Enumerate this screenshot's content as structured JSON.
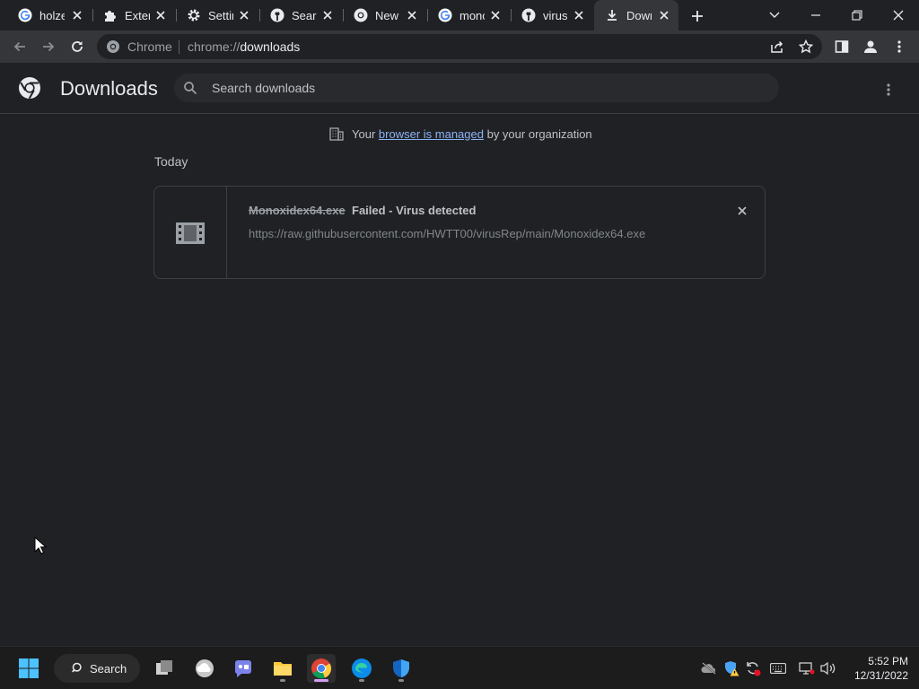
{
  "tabs": [
    {
      "label": "holze",
      "icon": "google-icon",
      "active": false
    },
    {
      "label": "Exten",
      "icon": "puzzle-icon",
      "active": false
    },
    {
      "label": "Settin",
      "icon": "gear-icon",
      "active": false
    },
    {
      "label": "Searc",
      "icon": "github-icon",
      "active": false
    },
    {
      "label": "New",
      "icon": "chrome-icon",
      "active": false
    },
    {
      "label": "monc",
      "icon": "google-icon",
      "active": false
    },
    {
      "label": "virusF",
      "icon": "github-icon",
      "active": false
    },
    {
      "label": "Dowr",
      "icon": "download-icon",
      "active": true
    }
  ],
  "omnibox": {
    "site_label": "Chrome",
    "url_scheme": "chrome://",
    "url_host": "downloads"
  },
  "downloads": {
    "title": "Downloads",
    "search_placeholder": "Search downloads",
    "managed_prefix": "Your",
    "managed_link": "browser is managed",
    "managed_suffix": "by your organization",
    "group_label": "Today",
    "item": {
      "filename": "Monoxidex64.exe",
      "status": "Failed - Virus detected",
      "url": "https://raw.githubusercontent.com/HWTT00/virusRep/main/Monoxidex64.exe"
    }
  },
  "taskbar": {
    "search_label": "Search",
    "time": "5:52 PM",
    "date": "12/31/2022"
  },
  "colors": {
    "page_bg": "#202124",
    "toolbar_bg": "#35363a",
    "link": "#8ab4f8",
    "taskbar_bg": "#1c1c1c"
  }
}
